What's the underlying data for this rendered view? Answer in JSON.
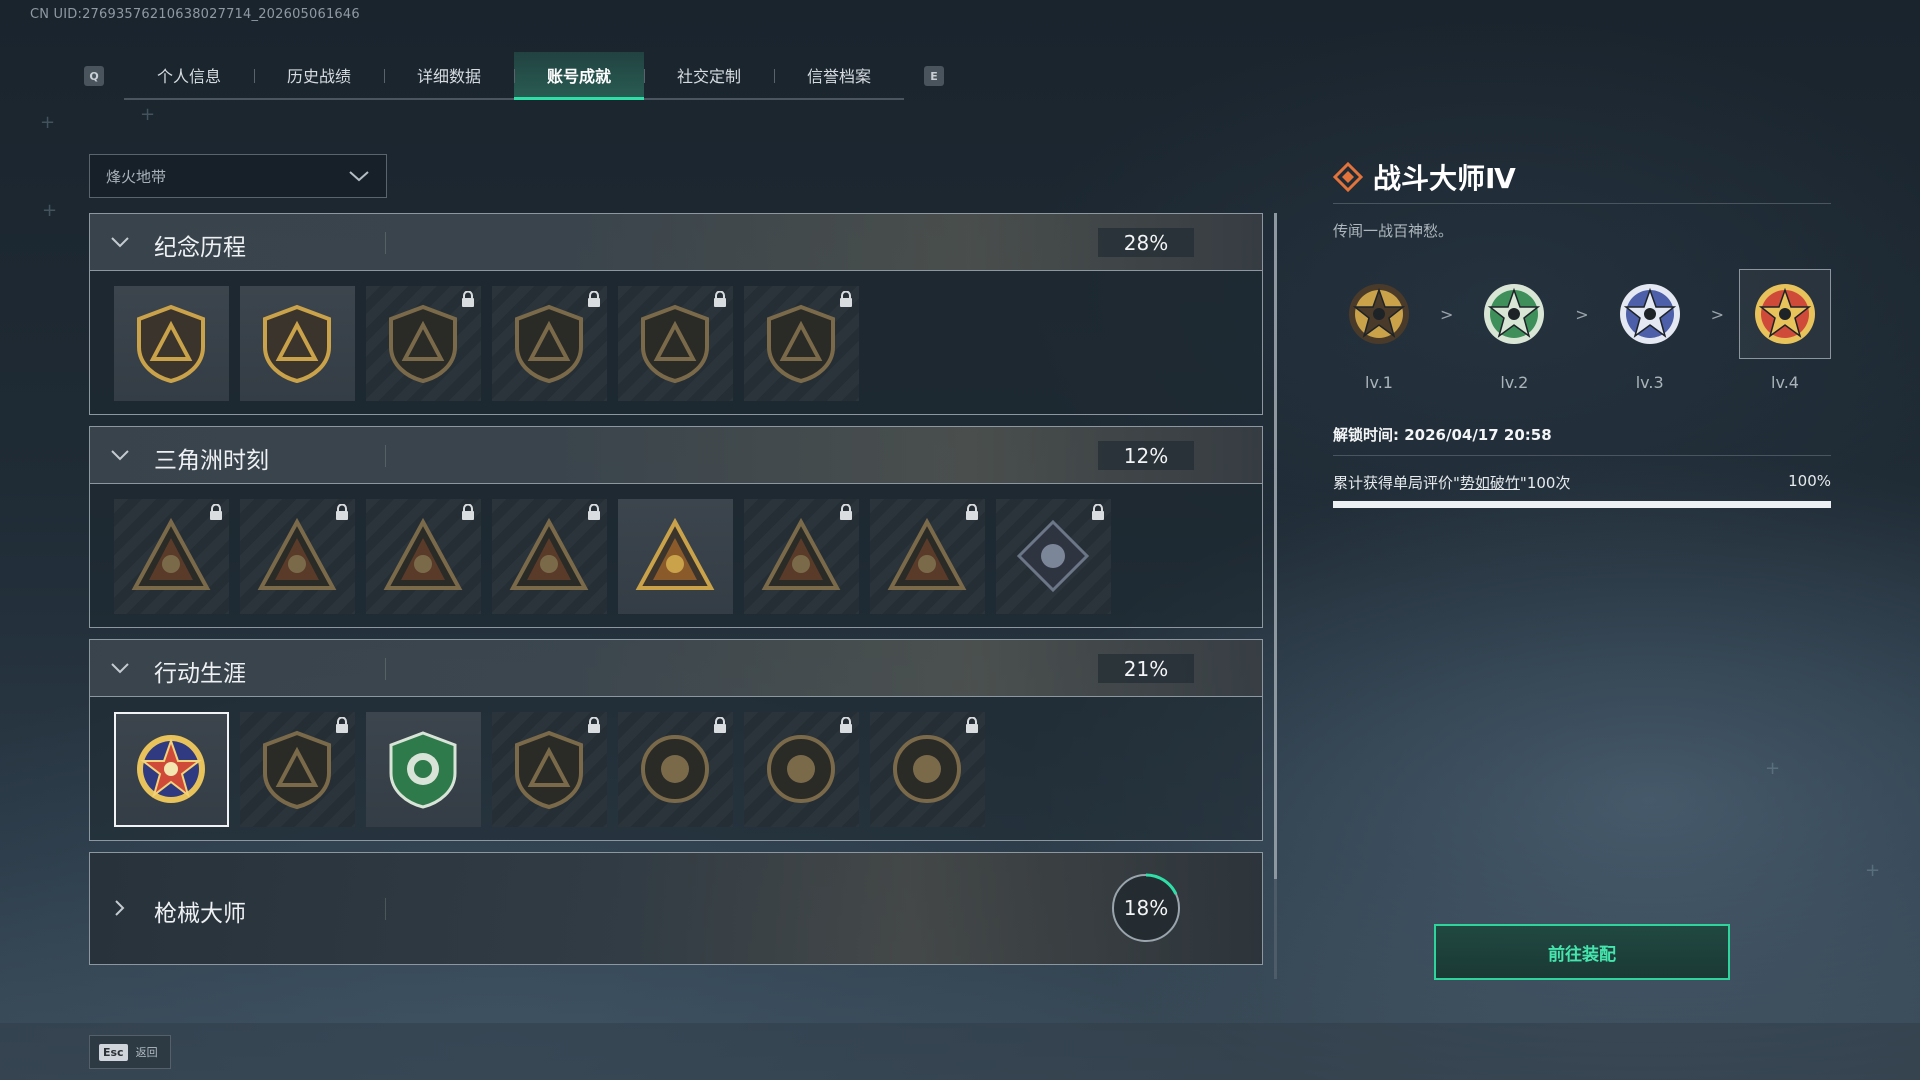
{
  "uid_text": "CN UID:2769357621063802771​4_202605061646",
  "header": {
    "q_key": "Q",
    "e_key": "E",
    "tabs": [
      "个人信息",
      "历史战绩",
      "详细数据",
      "账号成就",
      "社交定制",
      "信誉档案"
    ],
    "active_tab": 3
  },
  "filter": {
    "selected": "烽火地带"
  },
  "categories": [
    {
      "title": "纪念历程",
      "code": "001",
      "progress": "28%",
      "expanded": true,
      "badges": [
        {
          "icon": "triangle-shield",
          "locked": false
        },
        {
          "icon": "helicopter-shield",
          "locked": false
        },
        {
          "icon": "hex-emblem",
          "locked": true
        },
        {
          "icon": "robot-emblem",
          "locked": true
        },
        {
          "icon": "hooded-figure",
          "locked": true
        },
        {
          "icon": "crossed-swords",
          "locked": true
        }
      ]
    },
    {
      "title": "三角洲时刻",
      "code": "002",
      "progress": "12%",
      "expanded": true,
      "badges": [
        {
          "icon": "bottle-triangle",
          "locked": true
        },
        {
          "icon": "armor-triangle",
          "locked": true
        },
        {
          "icon": "runner-triangle",
          "locked": true
        },
        {
          "icon": "dice-triangle",
          "locked": true
        },
        {
          "icon": "team-triangle",
          "locked": false
        },
        {
          "icon": "beast-triangle",
          "locked": true
        },
        {
          "icon": "dragon-triangle",
          "locked": true
        },
        {
          "icon": "rose-diamond",
          "locked": true
        }
      ]
    },
    {
      "title": "行动生涯",
      "code": "003",
      "progress": "21%",
      "expanded": true,
      "badges": [
        {
          "icon": "star-medal",
          "locked": false,
          "selected": true
        },
        {
          "icon": "wing-shield",
          "locked": true
        },
        {
          "icon": "green-shield",
          "locked": false
        },
        {
          "icon": "hex-dark-shield",
          "locked": true
        },
        {
          "icon": "helmet-medal",
          "locked": true
        },
        {
          "icon": "skull-medal",
          "locked": true
        },
        {
          "icon": "eye-medal",
          "locked": true
        }
      ]
    },
    {
      "title": "枪械大师",
      "code": "004",
      "progress": "18%",
      "expanded": false,
      "progress_value": 0.18
    }
  ],
  "detail": {
    "title": "战斗大师Ⅳ",
    "description": "传闻一战百神愁。",
    "levels": [
      {
        "label": "lv.1",
        "color": "#c9a24a",
        "accent": "#4a3a2a"
      },
      {
        "label": "lv.2",
        "color": "#3f8f5a",
        "accent": "#d9e6d6"
      },
      {
        "label": "lv.3",
        "color": "#4c5fa8",
        "accent": "#e4e8f3"
      },
      {
        "label": "lv.4",
        "color": "#d04a3a",
        "accent": "#e8c25a"
      }
    ],
    "arrow": ">",
    "current_level": 3,
    "unlock_time": "解锁时间: 2026/04/17 20:58",
    "requirement_prefix": "累计获得单局评价\"",
    "requirement_link": "势如破竹",
    "requirement_suffix": "\"100次",
    "requirement_percent": "100%",
    "requirement_value": 1.0
  },
  "actions": {
    "equip_label": "前往装配"
  },
  "footer": {
    "esc_key": "Esc",
    "esc_label": "返回"
  },
  "colors": {
    "accent_green": "#2ee0a8",
    "gold": "#c9a24a"
  }
}
